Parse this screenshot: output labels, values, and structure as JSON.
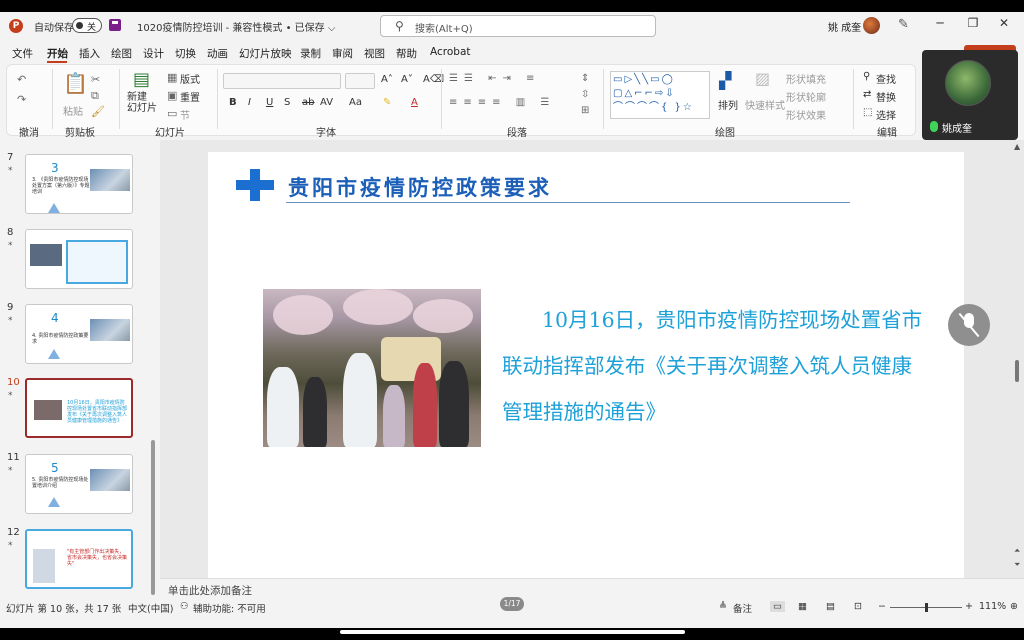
{
  "titlebar": {
    "autosave_label": "自动保存",
    "autosave_state": "关",
    "doc_title": "1020疫情防控培训 - 兼容性模式 • 已保存 ⌵",
    "search_placeholder": "搜索(Alt+Q)",
    "user_name": "姚 成奎"
  },
  "menu": [
    "文件",
    "开始",
    "插入",
    "绘图",
    "设计",
    "切换",
    "动画",
    "幻灯片放映",
    "录制",
    "审阅",
    "视图",
    "帮助",
    "Acrobat"
  ],
  "ribbon": {
    "groups": {
      "undo": "撤消",
      "clipboard": "剪贴板",
      "slides": "幻灯片",
      "font": "字体",
      "paragraph": "段落",
      "drawing": "绘图",
      "editing": "编辑"
    },
    "paste": "粘贴",
    "new_slide": "新建\n幻灯片",
    "layout": "版式",
    "reset": "重置",
    "section": "节",
    "arrange": "排列",
    "quick_styles": "快速样式",
    "shape_fill": "形状填充",
    "shape_outline": "形状轮廓",
    "shape_effects": "形状效果",
    "find": "查找",
    "replace": "替换",
    "select": "选择"
  },
  "video": {
    "name": "姚成奎"
  },
  "thumbnails": [
    {
      "num": "7",
      "big": "3",
      "text": "3. 《贵阳市疫情防控现场处置方案（第六版）》专题培训"
    },
    {
      "num": "8",
      "big": "",
      "text": ""
    },
    {
      "num": "9",
      "big": "4",
      "text": "4. 贵阳市疫情防控政策要求"
    },
    {
      "num": "10",
      "big": "",
      "text": "10月16日，贵阳市疫情防控现场处置省市联动指挥部发布《关于再次调整入筑人员健康管理措施的通告》"
    },
    {
      "num": "11",
      "big": "5",
      "text": "5. 贵阳市疫情防控现场处置培训介绍"
    },
    {
      "num": "12",
      "big": "",
      "text": "\"有主管部门作出决策失，省市会决策失，也省会决策失\""
    },
    {
      "num": "13",
      "big": "",
      "text": ""
    }
  ],
  "slide": {
    "title": "贵阳市疫情防控政策要求",
    "body": "10月16日，贵阳市疫情防控现场处置省市联动指挥部发布《关于再次调整入筑人员健康管理措施的通告》"
  },
  "notes_placeholder": "单击此处添加备注",
  "status": {
    "slide_count": "幻灯片 第 10 张，共 17 张",
    "language": "中文(中国)",
    "accessibility": "辅助功能: 不可用",
    "notes": "备注",
    "zoom": "111%",
    "page_pill": "1/17"
  }
}
